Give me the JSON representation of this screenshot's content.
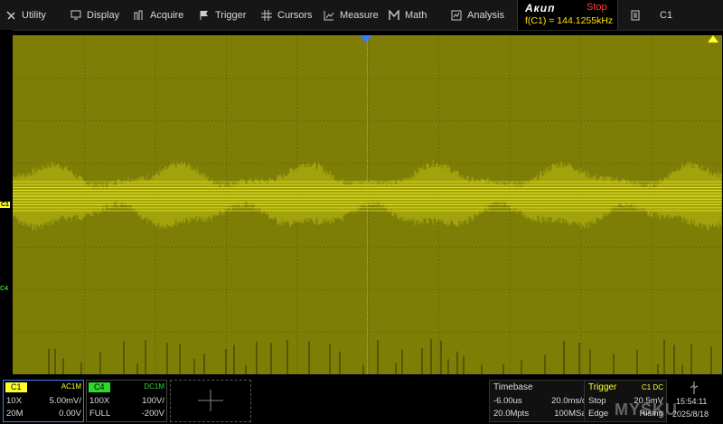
{
  "menu": [
    {
      "label": "Utility",
      "icon": "utility-icon"
    },
    {
      "label": "Display",
      "icon": "display-icon"
    },
    {
      "label": "Acquire",
      "icon": "acquire-icon"
    },
    {
      "label": "Trigger",
      "icon": "trigger-flag-icon"
    },
    {
      "label": "Cursors",
      "icon": "cursors-icon"
    },
    {
      "label": "Measure",
      "icon": "measure-icon"
    },
    {
      "label": "Math",
      "icon": "math-icon"
    },
    {
      "label": "Analysis",
      "icon": "analysis-icon"
    }
  ],
  "brand": "Акип",
  "run_state": "Stop",
  "frequency": "f(C1) = 144.1255kHz",
  "channel_selector": "C1",
  "markers": {
    "c1": "C1",
    "c4": "C4"
  },
  "channel1": {
    "tag": "C1",
    "coupling": "AC1M",
    "probe": "10X",
    "scale": "5.00mV/",
    "bw": "20M",
    "offset": "0.00V"
  },
  "channel4": {
    "tag": "C4",
    "coupling": "DC1M",
    "probe": "100X",
    "scale": "100V/",
    "bw": "FULL",
    "offset": "-200V"
  },
  "timebase": {
    "title": "Timebase",
    "delay": "-6.00us",
    "scale": "20.0ms/div",
    "points": "20.0Mpts",
    "rate": "100MSa/s"
  },
  "trigger": {
    "title": "Trigger",
    "source": "C1 DC",
    "mode": "Stop",
    "level": "20.5mV",
    "type": "Edge",
    "slope": "Rising"
  },
  "clock": {
    "time": "15:54:11",
    "date": "2025/8/18"
  },
  "watermark": "MYSKU",
  "colors": {
    "c1": "#ffff28",
    "c4": "#2bd92b",
    "grid_bg": "#7a7a06",
    "stop": "#ff3a3a"
  }
}
